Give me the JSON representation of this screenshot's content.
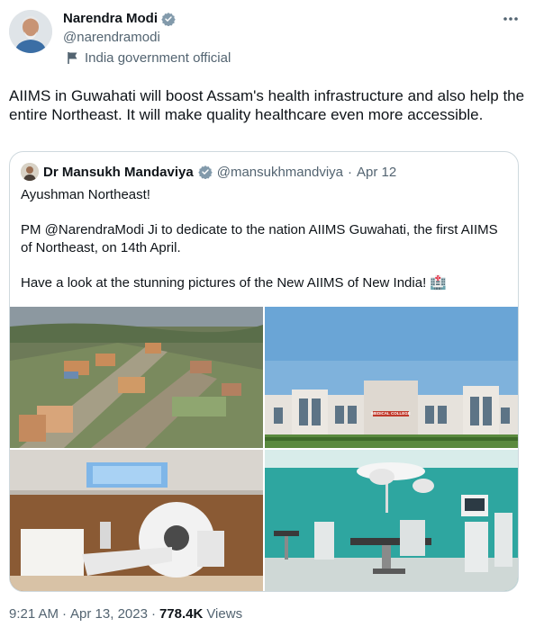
{
  "author": {
    "name": "Narendra Modi",
    "handle": "@narendramodi",
    "label": "India government official",
    "verified_color": "#829aab"
  },
  "tweet": {
    "text": "AIIMS in Guwahati will boost Assam's health infrastructure and also help the entire Northeast. It will make quality healthcare even more accessible."
  },
  "quote": {
    "name": "Dr Mansukh Mandaviya",
    "handle": "@mansukhmandviya",
    "separator": "·",
    "date": "Apr 12",
    "lines": [
      "Ayushman Northeast!",
      "PM @NarendraModi Ji to dedicate to the nation AIIMS Guwahati, the first AIIMS of Northeast, on 14th April.",
      "Have a look at the stunning pictures of the New AIIMS of New India! 🏥"
    ],
    "images": [
      "aerial-campus-image",
      "hospital-building-image",
      "mri-room-image",
      "operation-theatre-image"
    ],
    "building_sign": "MEDICAL COLLEGE"
  },
  "footer": {
    "time": "9:21 AM",
    "separator": "·",
    "date": "Apr 13, 2023",
    "views_count": "778.4K",
    "views_label": "Views"
  },
  "icons": {
    "verified": "verified-badge-icon",
    "more": "more-options-icon",
    "flag": "flag-icon"
  }
}
